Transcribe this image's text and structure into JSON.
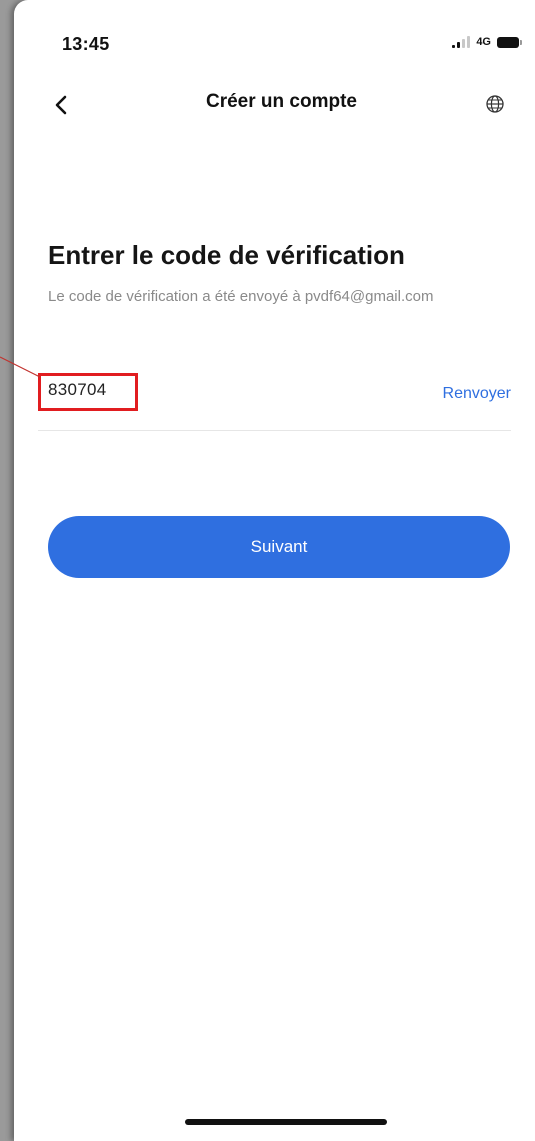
{
  "status_bar": {
    "time": "13:45",
    "network": "4G"
  },
  "nav": {
    "title": "Créer un compte",
    "back_icon": "chevron-left-icon",
    "language_icon": "globe-icon"
  },
  "main": {
    "heading": "Entrer le code de vérification",
    "subtitle": "Le code de vérification a été envoyé à pvdf64@gmail.com",
    "code_value": "830704",
    "resend_label": "Renvoyer",
    "next_label": "Suivant"
  },
  "colors": {
    "accent": "#2f6fe0",
    "highlight": "#e11d20"
  }
}
